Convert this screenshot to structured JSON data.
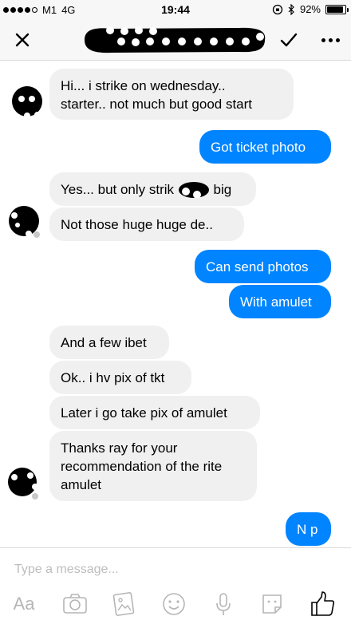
{
  "status_bar": {
    "carrier": "M1",
    "network": "4G",
    "time": "19:44",
    "battery": "92%",
    "battery_level": 0.92
  },
  "header": {
    "close_icon": "close-icon",
    "check_icon": "checkmark-icon",
    "more_icon": "more-options-icon"
  },
  "messages": [
    {
      "side": "in",
      "text_lines": [
        "Hi... i strike on wednesday..",
        "starter.. not much but good start"
      ]
    },
    {
      "side": "out",
      "text": "Got ticket photo"
    },
    {
      "side": "in",
      "text_a": "Yes... but only strik",
      "text_b": "big"
    },
    {
      "side": "in",
      "text": "Not those huge huge de.."
    },
    {
      "side": "out",
      "text": "Can send photos"
    },
    {
      "side": "out",
      "text": "With amulet"
    },
    {
      "side": "in",
      "text": "And a few ibet"
    },
    {
      "side": "in",
      "text": "Ok.. i hv pix of tkt"
    },
    {
      "side": "in",
      "text": "Later i go take pix of amulet"
    },
    {
      "side": "in",
      "text_lines": [
        "Thanks ray for your",
        "recommendation of the rite",
        "amulet"
      ]
    },
    {
      "side": "out",
      "text": "N p"
    }
  ],
  "composer": {
    "placeholder": "Type a message...",
    "aa_label": "Aa",
    "tools": [
      "camera-icon",
      "gallery-icon",
      "emoji-icon",
      "microphone-icon",
      "sticker-icon",
      "like-icon"
    ]
  },
  "colors": {
    "outgoing_bubble": "#0084ff",
    "incoming_bubble": "#f1f0f0",
    "icon_gray": "#b5b5b5"
  }
}
